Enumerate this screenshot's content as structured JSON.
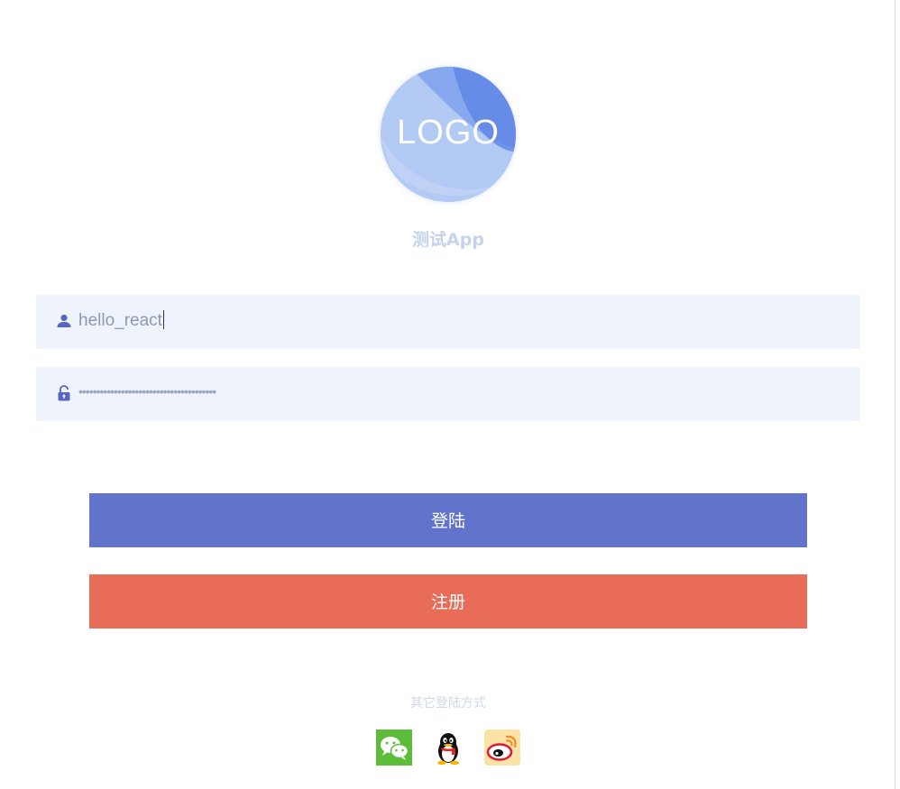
{
  "logo": {
    "text": "LOGO",
    "colors": {
      "base": "#a9c3f2",
      "mid": "#7fa2ec",
      "accent": "#5f84e6"
    },
    "icon": "logo-circle"
  },
  "app_name": "测试App",
  "login_form": {
    "username": {
      "icon": "user-icon",
      "value": "hello_react"
    },
    "password": {
      "icon": "unlock-icon",
      "masked_value": "•••••••••••••••••••••••••••••••••••••••"
    }
  },
  "buttons": {
    "login_label": "登陆",
    "register_label": "注册",
    "colors": {
      "login": "#6173cb",
      "register": "#e86c57"
    }
  },
  "other_login": {
    "label": "其它登陆方式",
    "providers": [
      {
        "name": "wechat",
        "icon": "wechat-icon",
        "color": "#5ebc3b"
      },
      {
        "name": "qq",
        "icon": "qq-penguin-icon",
        "color": "#000000"
      },
      {
        "name": "weibo",
        "icon": "weibo-icon",
        "color": "#e6162d"
      }
    ]
  }
}
